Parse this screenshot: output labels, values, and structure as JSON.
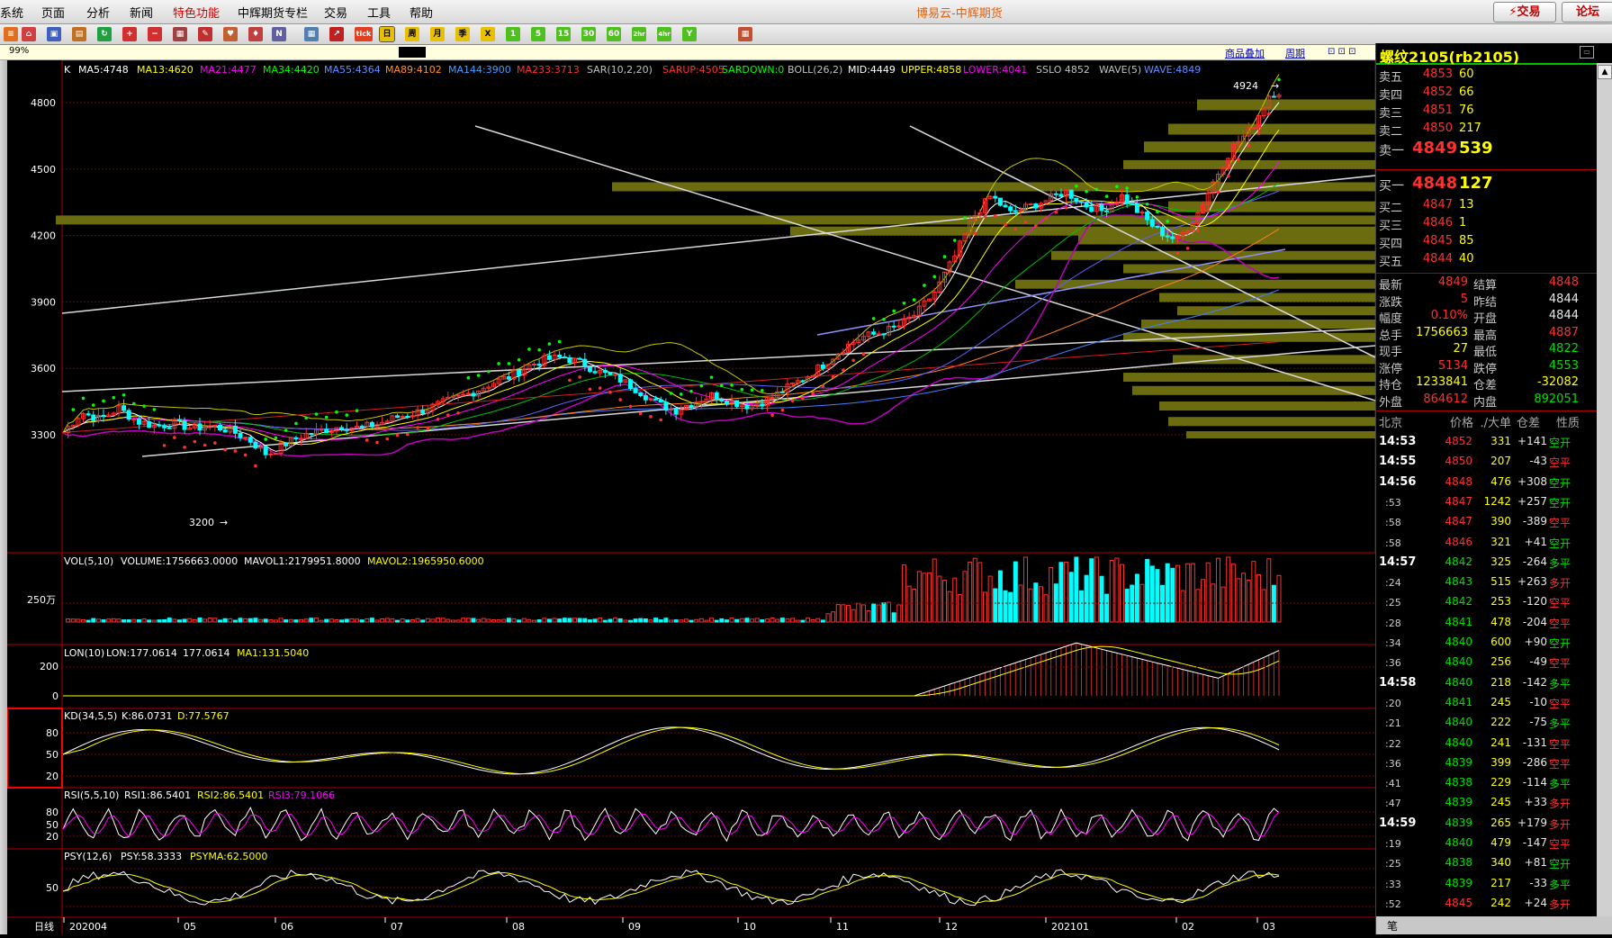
{
  "app": {
    "title": "博易云-中辉期货",
    "menu": [
      "系统",
      "页面",
      "分析",
      "新闻",
      "特色功能",
      "中辉期货专栏",
      "交易",
      "工具",
      "帮助"
    ],
    "trade_btn": "⚡交易",
    "forum_btn": "论坛"
  },
  "toolbar": {
    "buttons": [
      "home",
      "refresh",
      "zoom-in",
      "zoom-out",
      "draw",
      "fav",
      "new",
      "tick",
      "日",
      "周",
      "月",
      "季",
      "X",
      "1",
      "5",
      "15",
      "30",
      "60",
      "2hr",
      "4hr",
      "Y",
      "calc"
    ],
    "labels": {
      "tick": "tick",
      "day": "日",
      "week": "周",
      "month": "月",
      "season": "季",
      "m1": "1",
      "m5": "5",
      "m15": "15",
      "m30": "30",
      "m60": "60",
      "h2": "2hr",
      "h4": "4hr"
    }
  },
  "status": {
    "zoom": "99%",
    "overlay_link": "商品叠加",
    "period_link": "周期"
  },
  "chart_data": {
    "type": "candlestick",
    "period_label": "日线",
    "main_indicators": "K  MA5:4748  MA13:4620  MA21:4477  MA34:4420  MA55:4364  MA89:4102  MA144:3900  MA233:3713  SAR(10,2,20)  SARUP:4505  SARDOWN:0  BOLL(26,2)  MID:4449  UPPER:4858  LOWER:4041  SSLO 4852  WAVE(5)  WAVE:4849",
    "ma": {
      "K": "K",
      "MA5": "MA5:4748",
      "MA13": "MA13:4620",
      "MA21": "MA21:4477",
      "MA34": "MA34:4420",
      "MA55": "MA55:4364",
      "MA89": "MA89:4102",
      "MA144": "MA144:3900",
      "MA233": "MA233:3713",
      "SAR": "SAR(10,2,20)",
      "SARUP": "SARUP:4505",
      "SARDOWN": "SARDOWN:0",
      "BOLL": "BOLL(26,2)",
      "MID": "MID:4449",
      "UPPER": "UPPER:4858",
      "LOWER": "LOWER:4041",
      "SSLO": "SSLO 4852",
      "WAVE5": "WAVE(5)",
      "WAVE": "WAVE:4849"
    },
    "y_ticks": [
      4800,
      4500,
      4200,
      3900,
      3600,
      3300
    ],
    "y_range": [
      3050,
      4970
    ],
    "x_labels": [
      "202004",
      "05",
      "06",
      "07",
      "08",
      "09",
      "10",
      "11",
      "12",
      "202101",
      "02",
      "03"
    ],
    "annotations": {
      "high": "4924",
      "low": "3200"
    },
    "close_path": [
      [
        0,
        3310
      ],
      [
        10,
        3400
      ],
      [
        20,
        3370
      ],
      [
        30,
        3420
      ],
      [
        40,
        3360
      ],
      [
        50,
        3340
      ],
      [
        60,
        3350
      ],
      [
        70,
        3330
      ],
      [
        80,
        3340
      ],
      [
        90,
        3320
      ],
      [
        100,
        3280
      ],
      [
        110,
        3210
      ],
      [
        120,
        3260
      ],
      [
        130,
        3300
      ],
      [
        140,
        3320
      ],
      [
        150,
        3340
      ],
      [
        160,
        3330
      ],
      [
        170,
        3350
      ],
      [
        180,
        3380
      ],
      [
        190,
        3400
      ],
      [
        200,
        3430
      ],
      [
        210,
        3460
      ],
      [
        220,
        3490
      ],
      [
        230,
        3530
      ],
      [
        240,
        3560
      ],
      [
        250,
        3610
      ],
      [
        260,
        3640
      ],
      [
        270,
        3650
      ],
      [
        280,
        3620
      ],
      [
        290,
        3580
      ],
      [
        300,
        3550
      ],
      [
        310,
        3500
      ],
      [
        320,
        3440
      ],
      [
        330,
        3410
      ],
      [
        340,
        3450
      ],
      [
        350,
        3480
      ],
      [
        360,
        3450
      ],
      [
        370,
        3430
      ],
      [
        380,
        3460
      ],
      [
        390,
        3510
      ],
      [
        400,
        3560
      ],
      [
        410,
        3620
      ],
      [
        420,
        3690
      ],
      [
        430,
        3740
      ],
      [
        440,
        3760
      ],
      [
        450,
        3790
      ],
      [
        460,
        3850
      ],
      [
        470,
        3950
      ],
      [
        480,
        4100
      ],
      [
        490,
        4280
      ],
      [
        500,
        4380
      ],
      [
        510,
        4300
      ],
      [
        520,
        4330
      ],
      [
        530,
        4360
      ],
      [
        540,
        4400
      ],
      [
        550,
        4340
      ],
      [
        560,
        4310
      ],
      [
        570,
        4380
      ],
      [
        580,
        4300
      ],
      [
        590,
        4220
      ],
      [
        600,
        4180
      ],
      [
        610,
        4280
      ],
      [
        620,
        4450
      ],
      [
        630,
        4600
      ],
      [
        640,
        4680
      ],
      [
        650,
        4840
      ],
      [
        655,
        4849
      ]
    ],
    "volume": {
      "label": "VOL(5,10)",
      "value": "VOLUME:1756663.0000",
      "mavol1": "MAVOL1:2179951.8000",
      "mavol2": "MAVOL2:1965950.6000",
      "y_tick": "250万"
    },
    "lon": {
      "label": "LON(10)",
      "value": "LON:177.0614",
      "value2": "177.0614",
      "ma1": "MA1:131.5040",
      "y_ticks": [
        "200",
        "0"
      ]
    },
    "kd": {
      "label": "KD(34,5,5)",
      "k": "K:86.0731",
      "d": "D:77.5767",
      "y_ticks": [
        "80",
        "50",
        "20"
      ]
    },
    "rsi": {
      "label": "RSI(5,5,10)",
      "rsi1": "RSI1:86.5401",
      "rsi2": "RSI2:86.5401",
      "rsi3": "RSI3:79.1066",
      "y_ticks": [
        "80",
        "50",
        "20"
      ]
    },
    "psy": {
      "label": "PSY(12,6)",
      "psy": "PSY:58.3333",
      "psyma": "PSYMA:62.5000",
      "y_tick": "50"
    }
  },
  "quote": {
    "title": "螺纹2105(rb2105)",
    "asks": [
      {
        "label": "卖五",
        "price": "4853",
        "vol": "60"
      },
      {
        "label": "卖四",
        "price": "4852",
        "vol": "66"
      },
      {
        "label": "卖三",
        "price": "4851",
        "vol": "76"
      },
      {
        "label": "卖二",
        "price": "4850",
        "vol": "217"
      },
      {
        "label": "卖一",
        "price": "4849",
        "vol": "539"
      }
    ],
    "bids": [
      {
        "label": "买一",
        "price": "4848",
        "vol": "127"
      },
      {
        "label": "买二",
        "price": "4847",
        "vol": "13"
      },
      {
        "label": "买三",
        "price": "4846",
        "vol": "1"
      },
      {
        "label": "买四",
        "price": "4845",
        "vol": "85"
      },
      {
        "label": "买五",
        "price": "4844",
        "vol": "40"
      }
    ],
    "stats": [
      {
        "l1": "最新",
        "v1": "4849",
        "c1": "red",
        "l2": "结算",
        "v2": "4848",
        "c2": "red"
      },
      {
        "l1": "涨跌",
        "v1": "5",
        "c1": "red",
        "l2": "昨结",
        "v2": "4844",
        "c2": "white"
      },
      {
        "l1": "幅度",
        "v1": "0.10%",
        "c1": "red",
        "l2": "开盘",
        "v2": "4844",
        "c2": "white"
      },
      {
        "l1": "总手",
        "v1": "1756663",
        "c1": "yellow",
        "l2": "最高",
        "v2": "4887",
        "c2": "red"
      },
      {
        "l1": "现手",
        "v1": "27",
        "c1": "yellow",
        "l2": "最低",
        "v2": "4822",
        "c2": "green"
      },
      {
        "l1": "涨停",
        "v1": "5134",
        "c1": "red",
        "l2": "跌停",
        "v2": "4553",
        "c2": "green"
      },
      {
        "l1": "持仓",
        "v1": "1233841",
        "c1": "yellow",
        "l2": "仓差",
        "v2": "-32082",
        "c2": "yellow"
      },
      {
        "l1": "外盘",
        "v1": "864612",
        "c1": "red",
        "l2": "内盘",
        "v2": "892051",
        "c2": "green"
      }
    ],
    "tick_header": {
      "time": "北京",
      "price": "价格",
      "vol": "./大单",
      "diff": "仓差",
      "nature": "性质"
    },
    "ticks": [
      {
        "t": "14:53",
        "p": "4852",
        "v": "331",
        "d": "+141",
        "n": "空开",
        "pc": "red",
        "nc": "green"
      },
      {
        "t": "14:55",
        "p": "4850",
        "v": "207",
        "d": "-43",
        "n": "空平",
        "pc": "red",
        "nc": "red"
      },
      {
        "t": "14:56",
        "p": "4848",
        "v": "476",
        "d": "+308",
        "n": "空开",
        "pc": "red",
        "nc": "green"
      },
      {
        "t": ":53",
        "p": "4847",
        "v": "1242",
        "d": "+257",
        "n": "空开",
        "pc": "red",
        "nc": "green"
      },
      {
        "t": ":58",
        "p": "4847",
        "v": "390",
        "d": "-389",
        "n": "空平",
        "pc": "red",
        "nc": "red"
      },
      {
        "t": ":58",
        "p": "4846",
        "v": "321",
        "d": "+41",
        "n": "空开",
        "pc": "red",
        "nc": "green"
      },
      {
        "t": "14:57",
        "p": "4842",
        "v": "325",
        "d": "-264",
        "n": "多平",
        "pc": "green",
        "nc": "green"
      },
      {
        "t": ":24",
        "p": "4843",
        "v": "515",
        "d": "+263",
        "n": "多开",
        "pc": "green",
        "nc": "red"
      },
      {
        "t": ":25",
        "p": "4842",
        "v": "253",
        "d": "-120",
        "n": "空平",
        "pc": "green",
        "nc": "red"
      },
      {
        "t": ":28",
        "p": "4841",
        "v": "478",
        "d": "-204",
        "n": "空平",
        "pc": "green",
        "nc": "red"
      },
      {
        "t": ":34",
        "p": "4840",
        "v": "600",
        "d": "+90",
        "n": "空开",
        "pc": "green",
        "nc": "green"
      },
      {
        "t": ":36",
        "p": "4840",
        "v": "256",
        "d": "-49",
        "n": "空平",
        "pc": "green",
        "nc": "red"
      },
      {
        "t": "14:58",
        "p": "4840",
        "v": "218",
        "d": "-142",
        "n": "多平",
        "pc": "green",
        "nc": "green"
      },
      {
        "t": ":20",
        "p": "4841",
        "v": "245",
        "d": "-10",
        "n": "空平",
        "pc": "green",
        "nc": "red"
      },
      {
        "t": ":21",
        "p": "4840",
        "v": "222",
        "d": "-75",
        "n": "多平",
        "pc": "green",
        "nc": "green"
      },
      {
        "t": ":22",
        "p": "4840",
        "v": "241",
        "d": "-131",
        "n": "空平",
        "pc": "green",
        "nc": "red"
      },
      {
        "t": ":36",
        "p": "4839",
        "v": "399",
        "d": "-286",
        "n": "空平",
        "pc": "green",
        "nc": "red"
      },
      {
        "t": ":41",
        "p": "4838",
        "v": "229",
        "d": "-114",
        "n": "多平",
        "pc": "green",
        "nc": "green"
      },
      {
        "t": ":47",
        "p": "4839",
        "v": "245",
        "d": "+33",
        "n": "多开",
        "pc": "green",
        "nc": "red"
      },
      {
        "t": "14:59",
        "p": "4839",
        "v": "265",
        "d": "+179",
        "n": "多开",
        "pc": "green",
        "nc": "red"
      },
      {
        "t": ":19",
        "p": "4840",
        "v": "479",
        "d": "-147",
        "n": "空平",
        "pc": "green",
        "nc": "red"
      },
      {
        "t": ":25",
        "p": "4838",
        "v": "340",
        "d": "+81",
        "n": "空开",
        "pc": "green",
        "nc": "green"
      },
      {
        "t": ":33",
        "p": "4839",
        "v": "217",
        "d": "-33",
        "n": "多平",
        "pc": "green",
        "nc": "green"
      },
      {
        "t": ":52",
        "p": "4845",
        "v": "242",
        "d": "+24",
        "n": "多开",
        "pc": "red",
        "nc": "red"
      }
    ],
    "footer_tab": "笔"
  },
  "colors": {
    "up": "#ff3030",
    "down": "#00ffff",
    "grid": "#7a0000",
    "panel_border": "#b00000",
    "profile": "#6b6b10"
  }
}
